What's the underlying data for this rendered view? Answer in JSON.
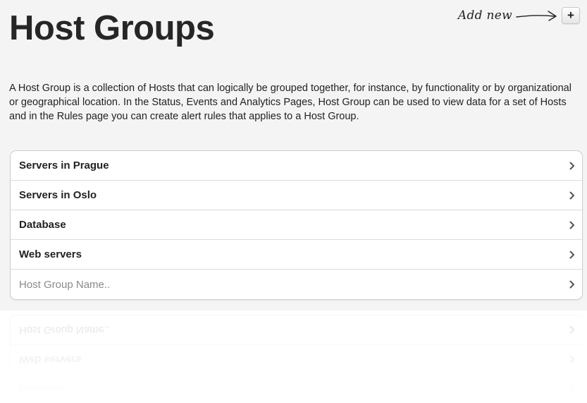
{
  "header": {
    "title": "Host Groups",
    "add_new_label": "Add new",
    "add_button_label": "+"
  },
  "description": "A Host Group is a collection of Hosts that can logically be grouped together, for instance, by functionality or by organizational or geographical location. In the Status, Events and Analytics Pages, Host Group can be used to view data for a set of Hosts and in the Rules page you can create alert rules that applies to a Host Group.",
  "host_groups": {
    "items": [
      {
        "label": "Servers in Prague"
      },
      {
        "label": "Servers in Oslo"
      },
      {
        "label": "Database"
      },
      {
        "label": "Web servers"
      }
    ],
    "new_group_input": {
      "value": "",
      "placeholder": "Host Group Name.."
    }
  },
  "reflection": {
    "items": [
      {
        "label": "Host Group Name..",
        "placeholder": true
      },
      {
        "label": "Web servers",
        "placeholder": false
      },
      {
        "label": "Database",
        "placeholder": false
      }
    ]
  },
  "colors": {
    "background_panel": "#f4f4f4",
    "text": "#222222",
    "placeholder": "#8a8a8a",
    "border": "#cfcfcf"
  },
  "icons": {
    "row_chevron": "chevron-right-icon",
    "add_arrow": "hand-drawn-arrow-icon"
  }
}
